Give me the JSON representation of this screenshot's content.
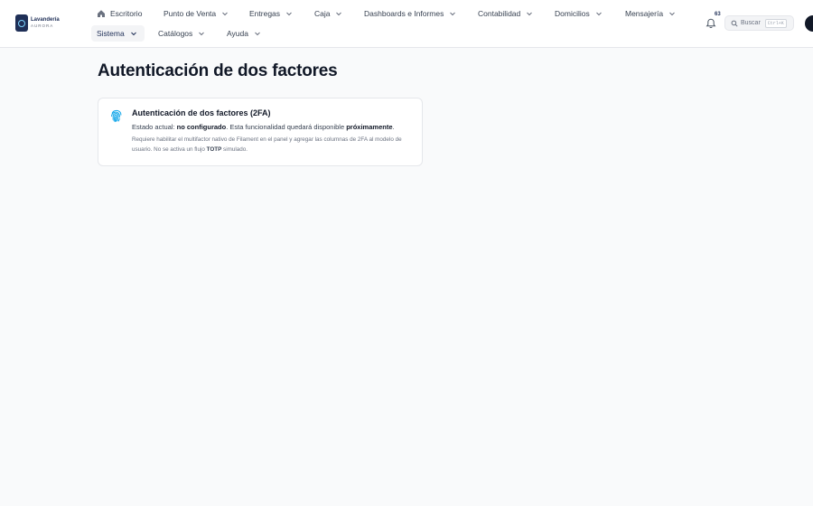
{
  "brand": {
    "name": "Lavandería",
    "subtitle": "AURORA"
  },
  "nav": {
    "home": "Escritorio",
    "pos": "Punto de Venta",
    "deliveries": "Entregas",
    "cash": "Caja",
    "dashboards": "Dashboards e Informes",
    "accounting": "Contabilidad",
    "homes": "Domicilios",
    "messaging": "Mensajería",
    "system": "Sistema",
    "catalogs": "Catálogos",
    "help": "Ayuda"
  },
  "notifications": {
    "count": "63"
  },
  "search": {
    "label": "Buscar",
    "shortcut": "Ctrl+K"
  },
  "page": {
    "title": "Autenticación de dos factores"
  },
  "card": {
    "title": "Autenticación de dos factores (2FA)",
    "status_prefix": "Estado actual: ",
    "status_value": "no configurado",
    "status_middle": ". Esta funcionalidad quedará disponible ",
    "status_highlight": "próximamente",
    "status_end": ".",
    "note_prefix": "Requiere habilitar el multifactor nativo de Filament en el panel y agregar las columnas de 2FA al modelo de usuario. No se activa un flujo ",
    "note_bold": "TOTP",
    "note_end": " simulado."
  },
  "colors": {
    "accent": "#1f2f57",
    "fingerprint": "#0ea5e9"
  }
}
